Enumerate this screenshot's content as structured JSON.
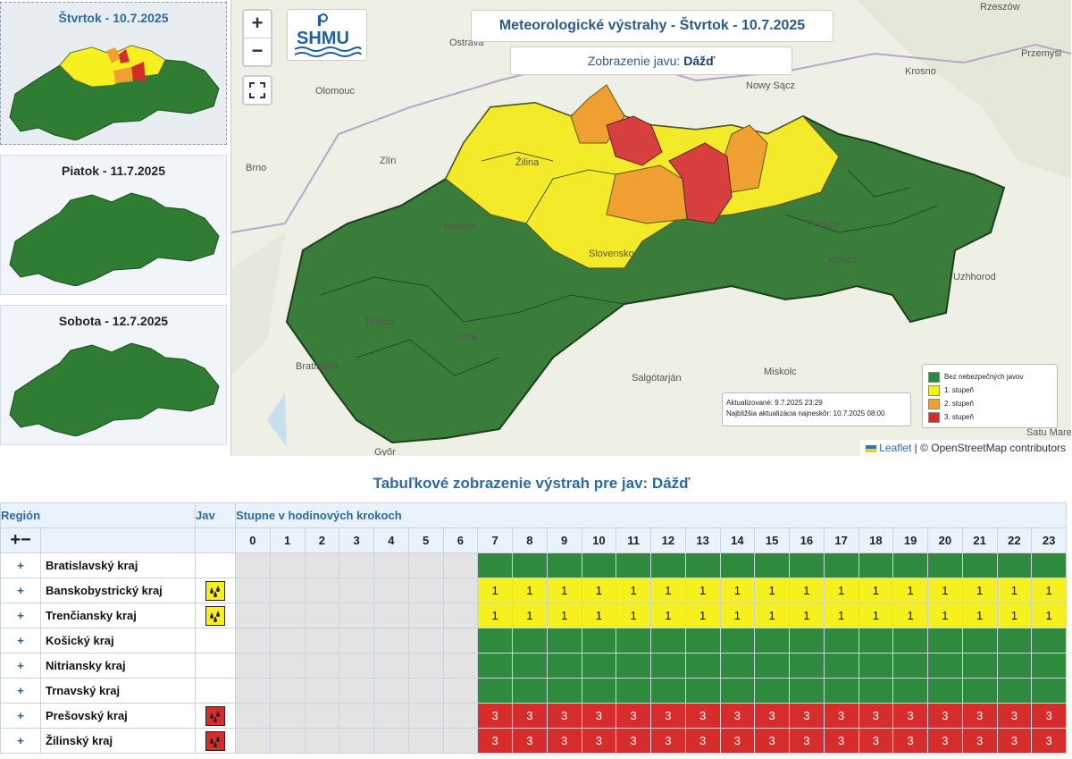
{
  "days": [
    {
      "label": "Štvrtok - 10.7.2025",
      "active": true
    },
    {
      "label": "Piatok - 11.7.2025",
      "active": false
    },
    {
      "label": "Sobota - 12.7.2025",
      "active": false
    }
  ],
  "map": {
    "zoom_in": "+",
    "zoom_out": "−",
    "logo_text": "SHMU",
    "title": "Meteorologické výstrahy - Štvrtok - 10.7.2025",
    "subtitle_prefix": "Zobrazenie javu: ",
    "subtitle_value": "Dážď",
    "cities": [
      "Ostrava",
      "Rzeszów",
      "Olomouc",
      "Nowy Sącz",
      "Krosno",
      "Przemyśl",
      "Zlín",
      "Brno",
      "Žilina",
      "Trenčín",
      "Prešov",
      "Košice",
      "Slovensko",
      "Uzhhorod",
      "Trnava",
      "Nitra",
      "Bratislava",
      "Salgótarján",
      "Miskolc",
      "Győr",
      "Satu Mare"
    ],
    "updated": "Aktualizované: 9.7.2025 23:29",
    "next_update": "Najbližšia aktualizácia najneskôr: 10.7.2025 08:00",
    "legend": [
      {
        "label": "Bez nebezpečných javov",
        "color": "#2e8b3e"
      },
      {
        "label": "1. stupeň",
        "color": "#f5f01e"
      },
      {
        "label": "2. stupeň",
        "color": "#f0a030"
      },
      {
        "label": "3. stupeň",
        "color": "#d62c2c"
      }
    ],
    "attribution_link": "Leaflet",
    "attribution_text": " | © OpenStreetMap contributors"
  },
  "table": {
    "title": "Tabuľkové zobrazenie výstrah pre jav: Dážď",
    "col_region": "Región",
    "col_jav": "Jav",
    "col_steps": "Stupne v hodinových krokoch",
    "expand_all": "+−",
    "hours": [
      "0",
      "1",
      "2",
      "3",
      "4",
      "5",
      "6",
      "7",
      "8",
      "9",
      "10",
      "11",
      "12",
      "13",
      "14",
      "15",
      "16",
      "17",
      "18",
      "19",
      "20",
      "21",
      "22",
      "23"
    ],
    "rows": [
      {
        "name": "Bratislavský kraj",
        "level": 0
      },
      {
        "name": "Banskobystrický kraj",
        "level": 1
      },
      {
        "name": "Trenčiansky kraj",
        "level": 1
      },
      {
        "name": "Košický kraj",
        "level": 0
      },
      {
        "name": "Nitriansky kraj",
        "level": 0
      },
      {
        "name": "Trnavský kraj",
        "level": 0
      },
      {
        "name": "Prešovský kraj",
        "level": 3
      },
      {
        "name": "Žilinský kraj",
        "level": 3
      }
    ]
  },
  "colors": {
    "green": "#2e8b3e",
    "yellow": "#f5f01e",
    "orange": "#f0a030",
    "red": "#d62c2c"
  }
}
